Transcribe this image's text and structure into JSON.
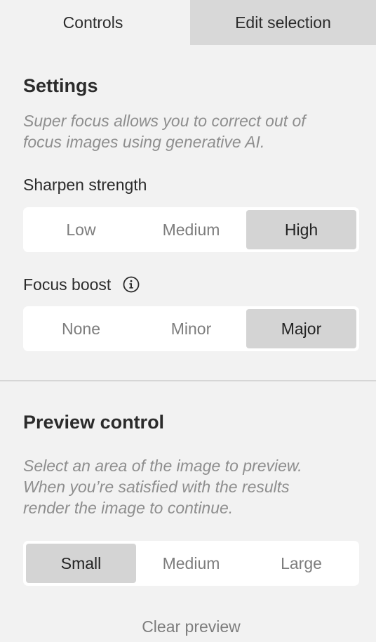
{
  "tabs": {
    "controls": "Controls",
    "edit_selection": "Edit selection"
  },
  "settings": {
    "title": "Settings",
    "description_line1": "Super focus allows you to correct out of",
    "description_line2": "focus images using generative AI.",
    "sharpen": {
      "label": "Sharpen strength",
      "options": [
        "Low",
        "Medium",
        "High"
      ],
      "selected": "High"
    },
    "focus_boost": {
      "label": "Focus boost",
      "info_icon": "info-icon",
      "options": [
        "None",
        "Minor",
        "Major"
      ],
      "selected": "Major"
    }
  },
  "preview": {
    "title": "Preview control",
    "description_line1": "Select an area of the image to preview.",
    "description_line2": "When you’re satisfied with the results",
    "description_line3": "render the image to continue.",
    "size": {
      "options": [
        "Small",
        "Medium",
        "Large"
      ],
      "selected": "Small"
    },
    "clear_label": "Clear preview"
  }
}
